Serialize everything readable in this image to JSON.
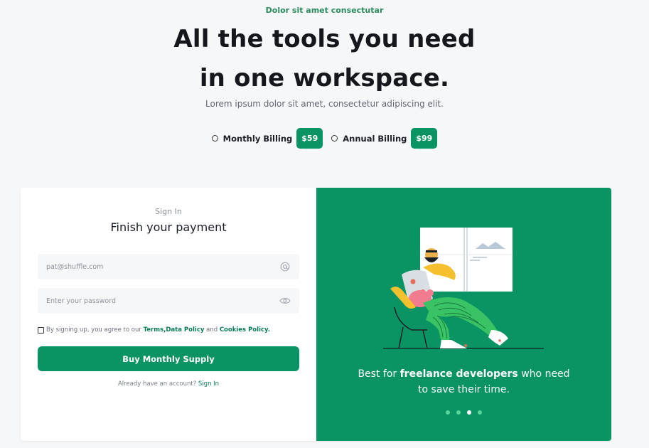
{
  "hero": {
    "eyebrow": "Dolor sit amet consectutar",
    "title_line1": "All the tools you need",
    "title_line2": "in one workspace.",
    "subtitle": "Lorem ipsum dolor sit amet, consectetur adipiscing elit."
  },
  "billing": {
    "options": [
      {
        "label": "Monthly Billing",
        "price": "$59"
      },
      {
        "label": "Annual Billing",
        "price": "$99"
      }
    ]
  },
  "form": {
    "small_title": "Sign In",
    "title": "Finish your payment",
    "email_placeholder": "pat@shuffle.com",
    "password_placeholder": "Enter your password",
    "terms_prefix": "By signing up, you agree to our",
    "terms_link1": "Terms,",
    "terms_link2": "Data Policy",
    "terms_and": "and",
    "terms_link3": "Cookies Policy.",
    "submit_label": "Buy Monthly Supply",
    "already_text": "Already have an account?",
    "sign_in_link": "Sign In"
  },
  "promo": {
    "prefix": "Best for",
    "highlight": "freelance developers",
    "suffix": "who need",
    "line2": "to save their time."
  },
  "carousel": {
    "slide_count": 4,
    "active_index": 2
  },
  "colors": {
    "brand": "#0a9463",
    "link": "#0a7d54",
    "background": "#f6f7f9"
  },
  "icons": {
    "email": "at-icon",
    "password": "eye-icon"
  }
}
